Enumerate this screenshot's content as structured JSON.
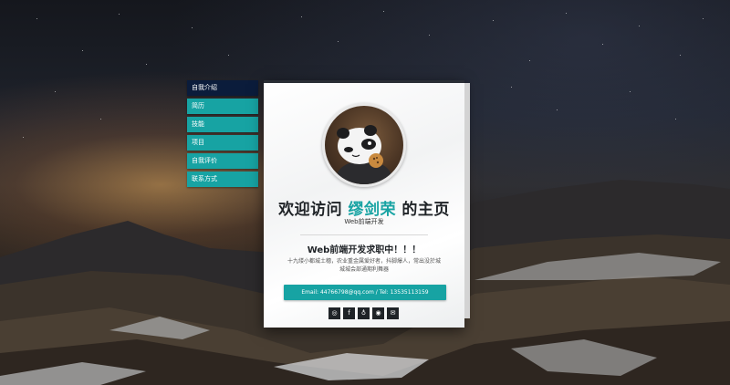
{
  "nav": {
    "items": [
      {
        "label": "自我介绍",
        "active": true
      },
      {
        "label": "简历",
        "active": false
      },
      {
        "label": "技能",
        "active": false
      },
      {
        "label": "项目",
        "active": false
      },
      {
        "label": "自我评价",
        "active": false
      },
      {
        "label": "联系方式",
        "active": false
      }
    ]
  },
  "card": {
    "title_prefix": "欢迎访问 ",
    "title_name": "缪剑荣",
    "title_suffix": " 的主页",
    "subtitle": "Web前端开发",
    "headline": "Web前端开发求职中！！！",
    "description": "十九缕小都城土穗，农业重金属爱好者，抖脚爆人，常出没於城城城会部通期利舞器",
    "contact": "Email: 44766798@qq.com / Tel: 13535113159",
    "socials": [
      {
        "icon": "instagram-icon",
        "glyph": "◎"
      },
      {
        "icon": "facebook-icon",
        "glyph": "f"
      },
      {
        "icon": "github-icon",
        "glyph": "♁"
      },
      {
        "icon": "weibo-icon",
        "glyph": "◉"
      },
      {
        "icon": "wechat-icon",
        "glyph": "✉"
      }
    ]
  },
  "colors": {
    "accent": "#17a3a3",
    "nav_active": "#0b1c3b",
    "dark": "#1f2327"
  }
}
